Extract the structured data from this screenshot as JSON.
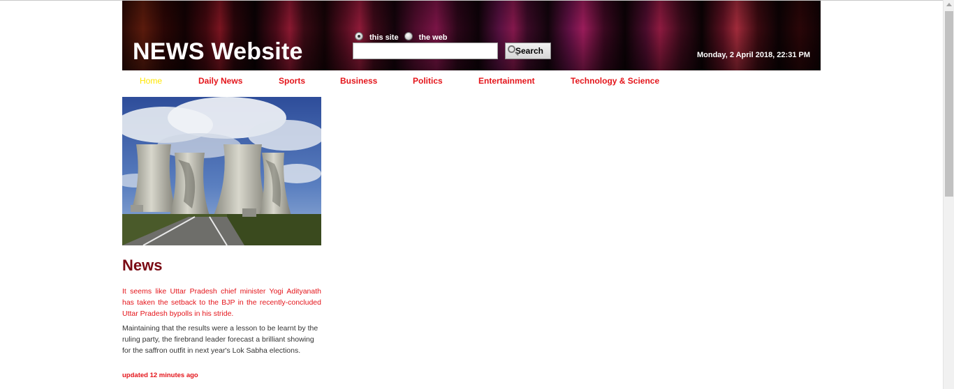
{
  "header": {
    "title": "NEWS Website",
    "search": {
      "option_site": "this site",
      "option_web": "the web",
      "selected": "this site",
      "input_value": "",
      "button_label": "Search"
    },
    "datetime": "Monday, 2 April 2018, 22:31 PM"
  },
  "nav": {
    "items": [
      {
        "label": "Home",
        "active": true
      },
      {
        "label": "Daily News"
      },
      {
        "label": "Sports"
      },
      {
        "label": "Business"
      },
      {
        "label": "Politics"
      },
      {
        "label": "Entertainment"
      },
      {
        "label": "Technology & Science"
      }
    ]
  },
  "article": {
    "image": "cooling-towers-photo",
    "heading": "News",
    "lead": "It seems like Uttar Pradesh chief minister Yogi Adityanath has taken the setback to the BJP in the recently-concluded Uttar Pradesh bypolls in his stride.",
    "body": "Maintaining that the results were a lesson to be learnt by the ruling party, the firebrand leader forecast a brilliant showing for the saffron outfit in next year's Lok Sabha elections.",
    "updated": "updated 12 minutes ago"
  },
  "colors": {
    "accent_red": "#e4141a",
    "heading_maroon": "#7a0a14",
    "active_nav": "#ffe600"
  }
}
